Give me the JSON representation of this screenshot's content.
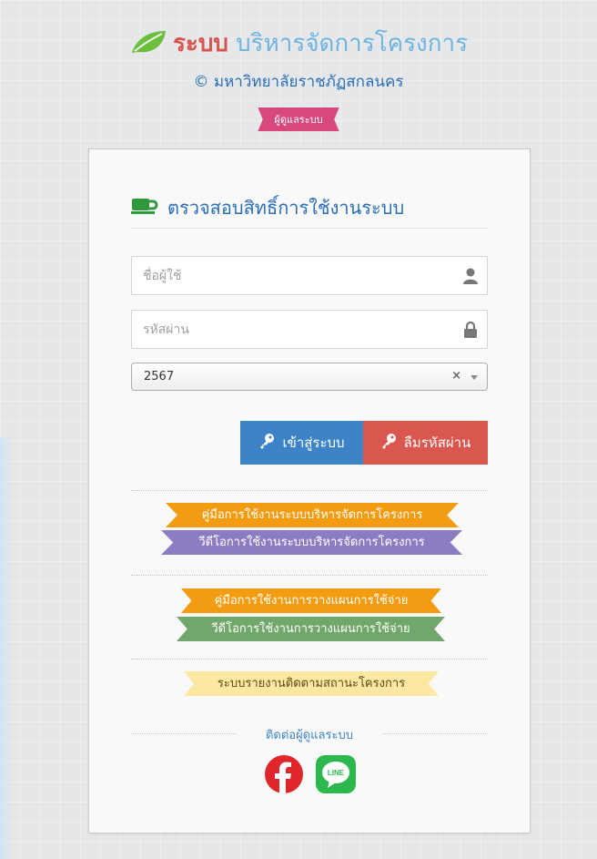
{
  "brand": {
    "title_part1": "ระบบ",
    "title_part2": "บริหารจัดการโครงการ",
    "subtitle": "© มหาวิทยาลัยราชภัฏสกลนคร",
    "ribbon": "ผู้ดูแลระบบ"
  },
  "card": {
    "title": "ตรวจสอบสิทธิ์การใช้งานระบบ",
    "username_placeholder": "ชื่อผู้ใช้",
    "username_value": "",
    "password_placeholder": "รหัสผ่าน",
    "password_value": "",
    "year_value": "2567",
    "clear_symbol": "×",
    "login_label": "เข้าสู่ระบบ",
    "forgot_label": "ลืมรหัสผ่าน"
  },
  "links": {
    "manual_project": "คู่มือการใช้งานระบบบริหารจัดการโครงการ",
    "video_project": "วีดีโอการใช้งานระบบบริหารจัดการโครงการ",
    "manual_plan": "คู่มือการใช้งานการวางแผนการใช้จ่าย",
    "video_plan": "วีดีโอการใช้งานการวางแผนการใช้จ่าย",
    "report": "ระบบรายงานติดตามสถานะโครงการ"
  },
  "contact": {
    "label": "ติดต่อผู้ดูแลระบบ",
    "line_text": "LINE"
  },
  "colors": {
    "brand_red": "#d9534f",
    "brand_blue": "#2a6ebb",
    "login_blue": "#3d84c6",
    "forgot_red": "#d9574f",
    "ribbon_pink": "#d6487e",
    "tag_orange": "#f39c12",
    "tag_purple": "#8e7cc3",
    "tag_green": "#71a76a",
    "tag_yellow": "#fde8a1",
    "facebook_red": "#e0252b",
    "line_green": "#2db84d"
  },
  "icons": [
    "leaf-icon",
    "coffee-cup-icon",
    "user-icon",
    "lock-icon",
    "key-icon",
    "facebook-icon",
    "line-icon"
  ]
}
